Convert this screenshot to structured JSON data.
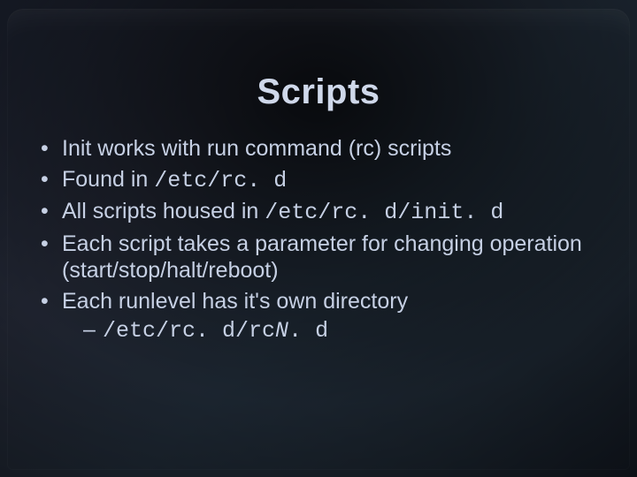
{
  "title": "Scripts",
  "bullets": {
    "b1": "Init works with run command (rc) scripts",
    "b2_a": "Found in ",
    "b2_code": "/etc/rc. d",
    "b3_a": "All scripts housed in ",
    "b3_code": "/etc/rc. d/init. d",
    "b4": "Each script takes a parameter for changing operation (start/stop/halt/reboot)",
    "b5": "Each runlevel has it's own directory",
    "b5_sub_code": "/etc/rc. d/rc",
    "b5_sub_ital": "N",
    "b5_sub_tail": ". d"
  }
}
